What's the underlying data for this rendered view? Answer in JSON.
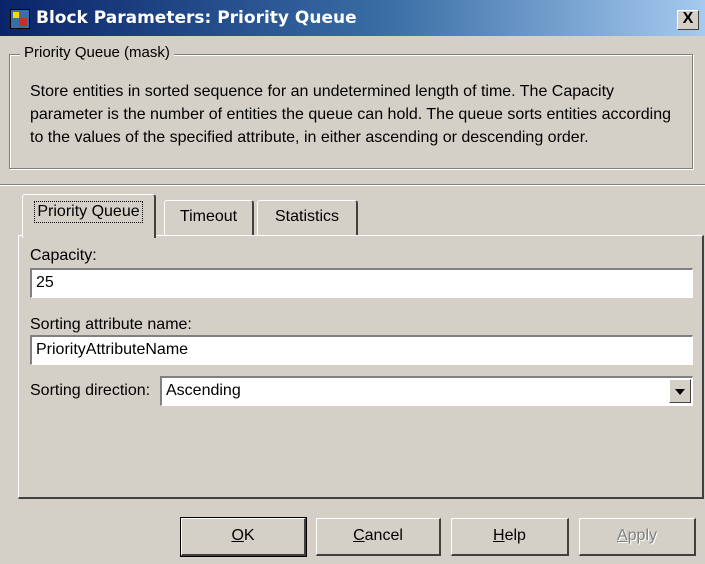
{
  "window": {
    "title": "Block Parameters: Priority Queue",
    "close_label": "X"
  },
  "mask": {
    "legend": "Priority Queue (mask)",
    "description": "Store entities in sorted sequence for an undetermined length of time. The Capacity parameter is the number of entities the queue can hold. The queue sorts entities according to the values of the specified attribute, in either ascending or descending order."
  },
  "tabs": [
    {
      "label": "Priority Queue",
      "active": true
    },
    {
      "label": "Timeout",
      "active": false
    },
    {
      "label": "Statistics",
      "active": false
    }
  ],
  "params": {
    "capacity_label": "Capacity:",
    "capacity_value": "25",
    "sorting_attr_label": "Sorting attribute name:",
    "sorting_attr_value": "PriorityAttributeName",
    "sorting_dir_label": "Sorting direction:",
    "sorting_dir_value": "Ascending"
  },
  "buttons": {
    "ok": "OK",
    "cancel": "Cancel",
    "help": "Help",
    "apply": "Apply"
  }
}
